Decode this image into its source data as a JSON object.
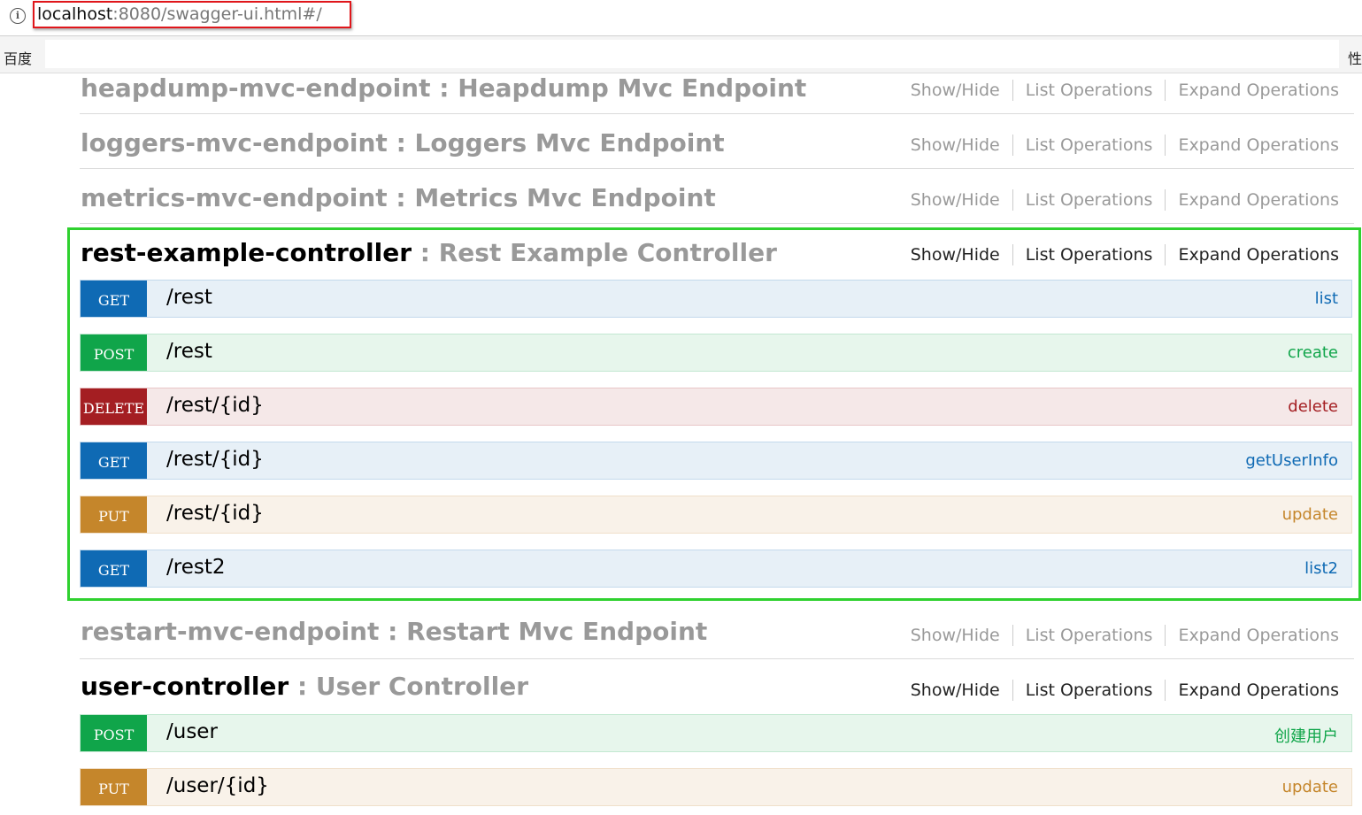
{
  "browser": {
    "url_host": "localhost",
    "url_rest": ":8080/swagger-ui.html#/",
    "info_icon": "info-icon",
    "bookmark_left": "百度",
    "bookmark_right": "性"
  },
  "links": {
    "show_hide": "Show/Hide",
    "list_ops": "List Operations",
    "expand_ops": "Expand Operations"
  },
  "resources": [
    {
      "name": "heapdump-mvc-endpoint",
      "sep": " : ",
      "desc": "Heapdump Mvc Endpoint"
    },
    {
      "name": "loggers-mvc-endpoint",
      "sep": " : ",
      "desc": "Loggers Mvc Endpoint"
    },
    {
      "name": "metrics-mvc-endpoint",
      "sep": " : ",
      "desc": "Metrics Mvc Endpoint"
    },
    {
      "name": "rest-example-controller",
      "sep": " : ",
      "desc": "Rest Example Controller"
    },
    {
      "name": "restart-mvc-endpoint",
      "sep": " : ",
      "desc": "Restart Mvc Endpoint"
    },
    {
      "name": "user-controller",
      "sep": " : ",
      "desc": "User Controller"
    }
  ],
  "operations": [
    {
      "method": "GET",
      "path": "/rest",
      "summary": "list"
    },
    {
      "method": "POST",
      "path": "/rest",
      "summary": "create"
    },
    {
      "method": "DELETE",
      "path": "/rest/{id}",
      "summary": "delete"
    },
    {
      "method": "GET",
      "path": "/rest/{id}",
      "summary": "getUserInfo"
    },
    {
      "method": "PUT",
      "path": "/rest/{id}",
      "summary": "update"
    },
    {
      "method": "GET",
      "path": "/rest2",
      "summary": "list2"
    },
    {
      "method": "POST",
      "path": "/user",
      "summary": "创建用户"
    },
    {
      "method": "PUT",
      "path": "/user/{id}",
      "summary": "update"
    }
  ],
  "colors": {
    "get": "#0f6ab4",
    "post": "#10a54a",
    "delete": "#a41e22",
    "put": "#c5862b",
    "highlight_url": "#e0161b",
    "highlight_section": "#2fd12f"
  }
}
